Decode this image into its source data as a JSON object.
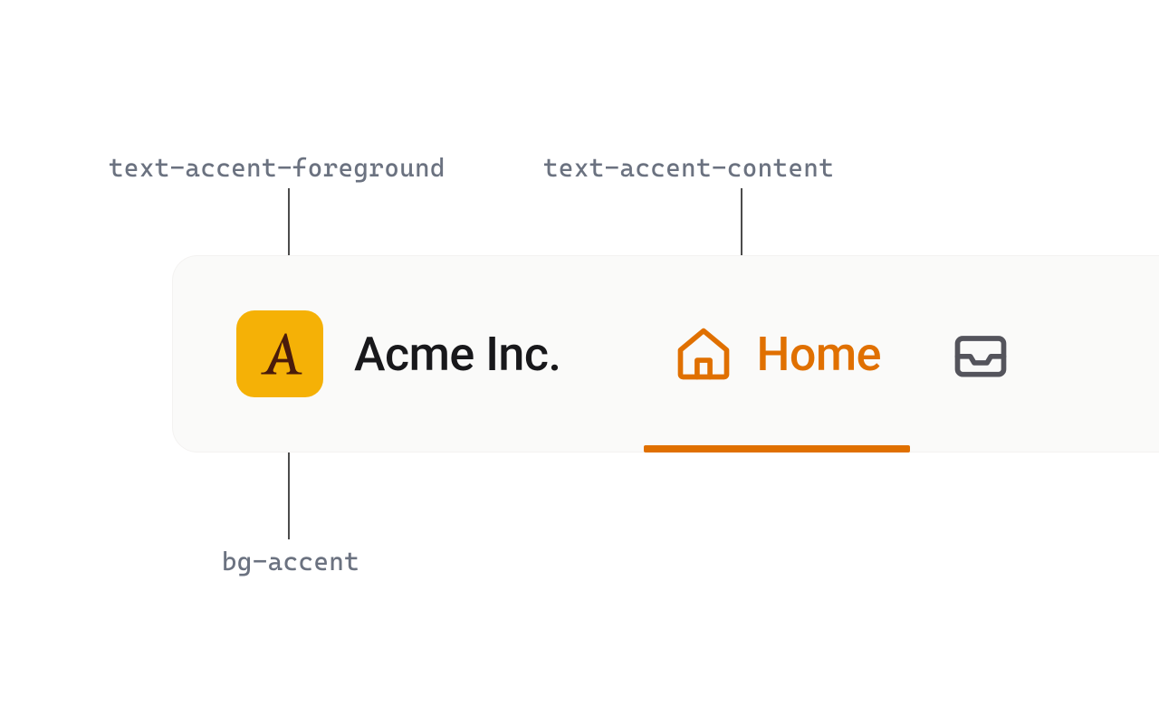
{
  "annotations": {
    "text_accent_foreground": "text-accent-foreground",
    "text_accent_content": "text-accent-content",
    "bg_accent": "bg-accent"
  },
  "navbar": {
    "brand_name": "Acme Inc.",
    "tabs": {
      "home_label": "Home"
    }
  },
  "colors": {
    "accent_bg": "#f5b106",
    "accent_content": "#e07000",
    "accent_foreground": "#4a1b0b"
  }
}
